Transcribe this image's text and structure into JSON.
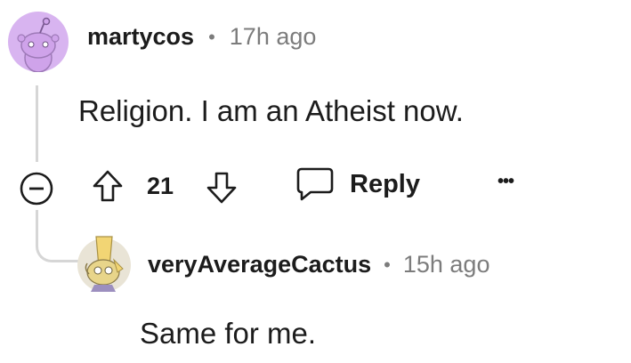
{
  "comment": {
    "username": "martycos",
    "separator": "•",
    "time": "17h ago",
    "body": "Religion. I am an Atheist now.",
    "avatar_icon": "snoo-avatar-icon",
    "avatar_color": "#d8b4f0"
  },
  "actions": {
    "collapse_icon": "collapse-minus-icon",
    "upvote_icon": "arrow-up-icon",
    "score": "21",
    "downvote_icon": "arrow-down-icon",
    "reply_icon": "speech-bubble-icon",
    "reply_label": "Reply",
    "more_label": "•••"
  },
  "reply": {
    "username": "veryAverageCactus",
    "separator": "•",
    "time": "15h ago",
    "body": "Same for me.",
    "avatar_icon": "cactus-avatar-icon"
  }
}
